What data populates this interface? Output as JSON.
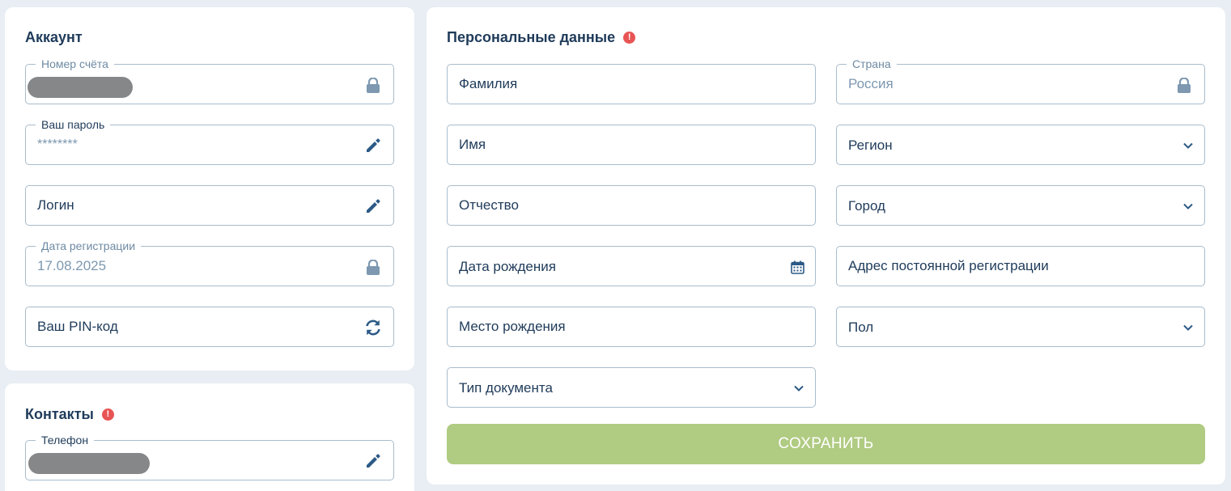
{
  "account": {
    "title": "Аккаунт",
    "account_number_label": "Номер счёта",
    "password_label": "Ваш пароль",
    "password_value": "********",
    "login_placeholder": "Логин",
    "reg_date_label": "Дата регистрации",
    "reg_date_value": "17.08.2025",
    "pin_placeholder": "Ваш PIN-код"
  },
  "contacts": {
    "title": "Контакты",
    "phone_label": "Телефон"
  },
  "personal": {
    "title": "Персональные данные",
    "last_name": "Фамилия",
    "first_name": "Имя",
    "patronymic": "Отчество",
    "birth_date": "Дата рождения",
    "birth_place": "Место рождения",
    "document_type": "Тип документа",
    "country_label": "Страна",
    "country_value": "Россия",
    "region": "Регион",
    "city": "Город",
    "address": "Адрес постоянной регистрации",
    "gender": "Пол",
    "save_label": "СОХРАНИТЬ"
  },
  "icons": {
    "alert": "exclamation-circle-icon",
    "lock": "lock-icon",
    "edit": "pencil-icon",
    "refresh": "refresh-icon",
    "calendar": "calendar-icon",
    "dropdown": "chevron-down-icon"
  },
  "colors": {
    "background": "#e8eef3",
    "primary_text": "#1f3b5a",
    "icon": "#2c5a86",
    "lock_icon": "#7d98b0",
    "alert": "#e85454",
    "save_button": "#b0cb82"
  }
}
